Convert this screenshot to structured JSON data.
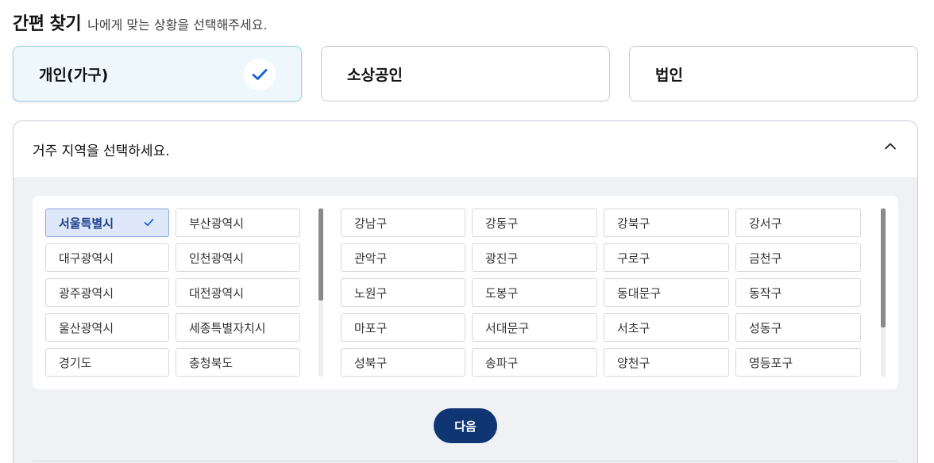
{
  "header": {
    "title": "간편 찾기",
    "subtitle": "나에게 맞는 상황을 선택해주세요."
  },
  "types": [
    {
      "label": "개인(가구)",
      "selected": true
    },
    {
      "label": "소상공인",
      "selected": false
    },
    {
      "label": "법인",
      "selected": false
    }
  ],
  "region": {
    "prompt": "거주 지역을 선택하세요.",
    "cities": [
      "서울특별시",
      "부산광역시",
      "대구광역시",
      "인천광역시",
      "광주광역시",
      "대전광역시",
      "울산광역시",
      "세종특별자치시",
      "경기도",
      "충청북도"
    ],
    "selected_city": "서울특별시",
    "districts": [
      "강남구",
      "강동구",
      "강북구",
      "강서구",
      "관악구",
      "광진구",
      "구로구",
      "금천구",
      "노원구",
      "도봉구",
      "동대문구",
      "동작구",
      "마포구",
      "서대문구",
      "서초구",
      "성동구",
      "성북구",
      "송파구",
      "양천구",
      "영등포구"
    ]
  },
  "next_label": "다음",
  "colors": {
    "accent": "#0f3572",
    "check": "#1a5fd6",
    "selected_card_bg": "#eef8fc",
    "selected_city_bg": "#dfe8fb"
  },
  "icons": [
    "check-icon",
    "chevron-up-icon"
  ]
}
